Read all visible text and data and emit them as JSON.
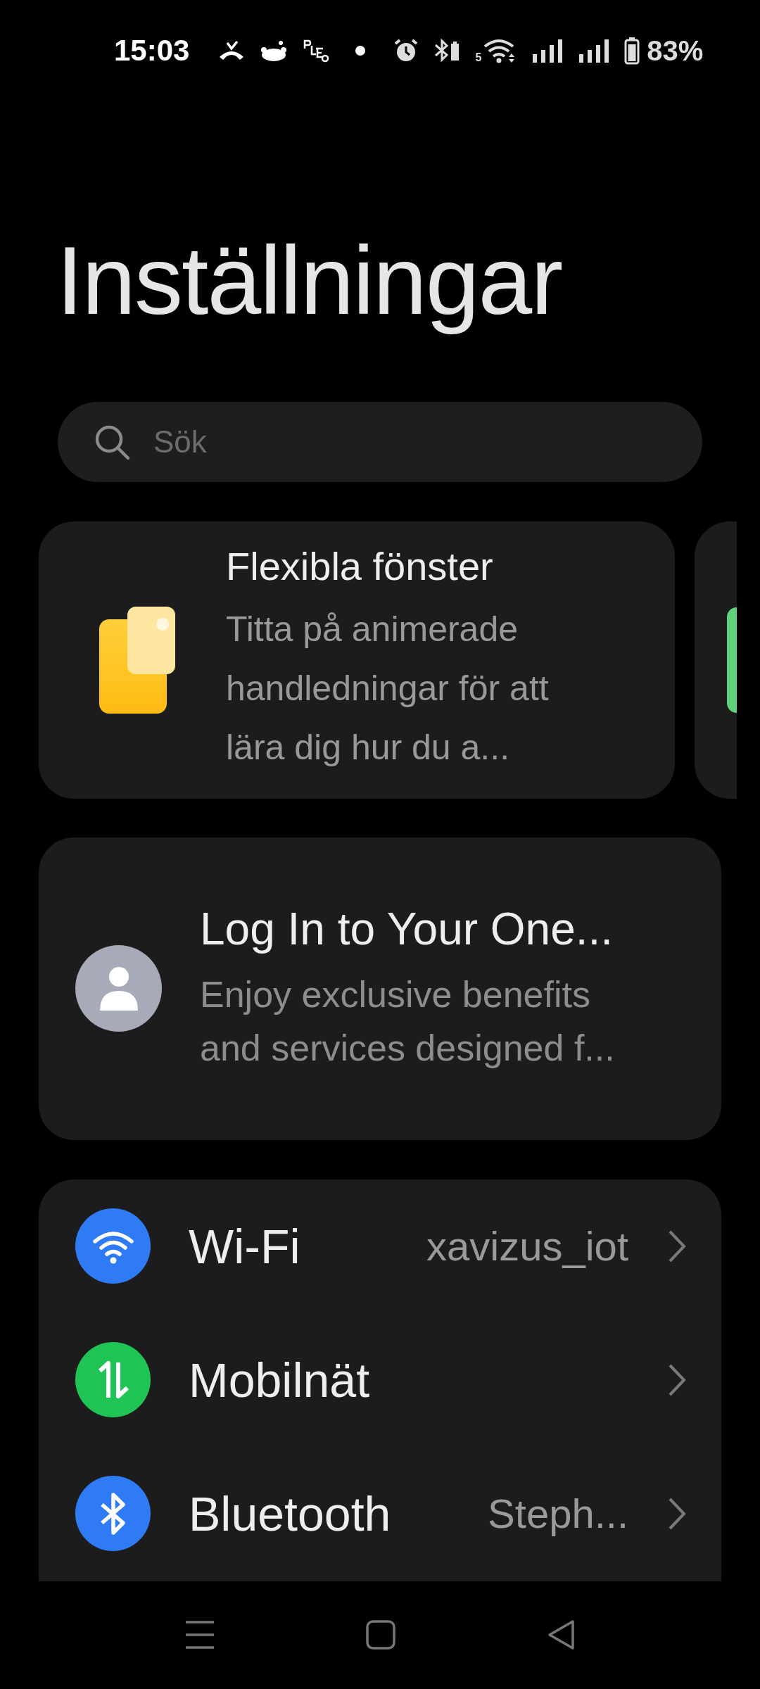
{
  "status_bar": {
    "time": "15:03",
    "wifi_badge": "5",
    "battery": "83%"
  },
  "title": "Inställningar",
  "search": {
    "placeholder": "Sök"
  },
  "tips": [
    {
      "title": "Flexibla fönster",
      "description": "Titta på animerade handledningar för att lära dig hur du a..."
    }
  ],
  "account": {
    "title": "Log In to Your One...",
    "description": "Enjoy exclusive benefits and services designed f..."
  },
  "settings": [
    {
      "kind": "wifi",
      "label": "Wi-Fi",
      "value": "xavizus_iot",
      "color": "#2f7bf5"
    },
    {
      "kind": "mobile",
      "label": "Mobilnät",
      "color": "#1fc454"
    },
    {
      "kind": "bluetooth",
      "label": "Bluetooth",
      "value": "Steph...",
      "color": "#2f7bf5"
    }
  ]
}
